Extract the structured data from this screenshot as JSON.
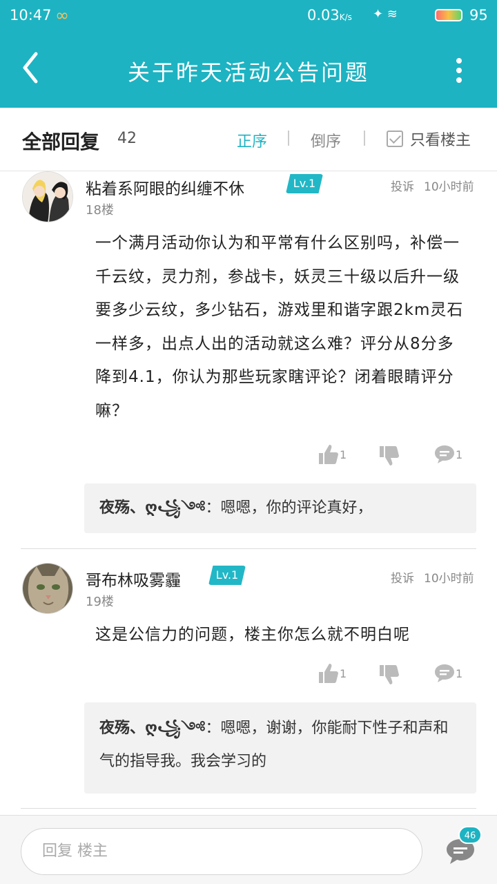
{
  "status_bar": {
    "time": "10:47",
    "speed": "0.03",
    "speed_unit": "K/s",
    "battery": "95"
  },
  "header": {
    "title": "关于昨天活动公告问题"
  },
  "sort_bar": {
    "all_replies_label": "全部回复",
    "reply_count": "42",
    "forward_label": "正序",
    "reverse_label": "倒序",
    "owner_only_label": "只看楼主"
  },
  "posts": [
    {
      "username": "粘着系阿眼的纠缠不休",
      "level": "Lv.1",
      "report_label": "投诉",
      "time": "10小时前",
      "floor": "18楼",
      "content": "一个满月活动你认为和平常有什么区别吗，补偿一千云纹，灵力剂，参战卡，妖灵三十级以后升一级要多少云纹，多少钻石，游戏里和谐字跟2km灵石一样多，出点人出的活动就这么难？评分从8分多降到4.1，你认为那些玩家瞎评论？闭着眼睛评分嘛？",
      "likes": "1",
      "comments": "1",
      "reply": {
        "name": "夜殇、ღ꧁༺",
        "text": "：嗯嗯，你的评论真好，"
      }
    },
    {
      "username": "哥布林吸雾霾",
      "level": "Lv.1",
      "report_label": "投诉",
      "time": "10小时前",
      "floor": "19楼",
      "content": "这是公信力的问题，楼主你怎么就不明白呢",
      "likes": "1",
      "comments": "1",
      "reply": {
        "name": "夜殇、ღ꧁༺",
        "text": "：嗯嗯，谢谢，你能耐下性子和声和气的指导我。我会学习的"
      }
    }
  ],
  "bottom_bar": {
    "input_placeholder": "回复 楼主",
    "comment_badge": "46"
  },
  "colors": {
    "accent": "#1db3c2",
    "text": "#222222",
    "muted": "#888888"
  }
}
